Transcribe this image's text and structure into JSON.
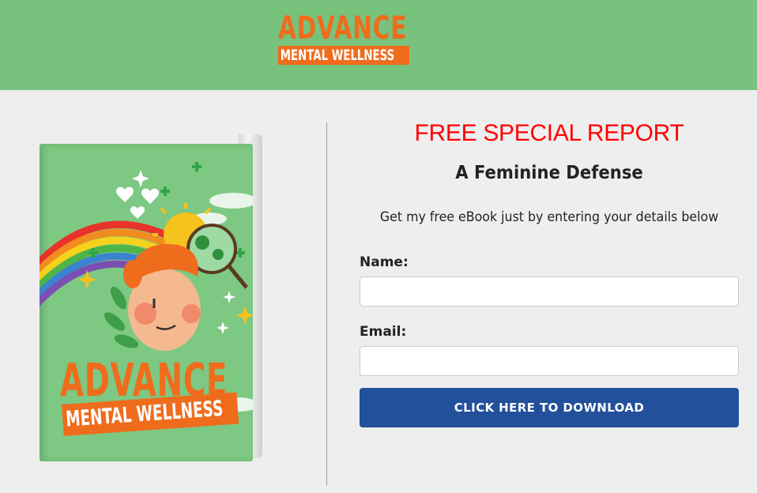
{
  "header": {
    "logo_title": "ADVANCE",
    "logo_subtitle": "MENTAL WELLNESS",
    "background_color": "#77c27d",
    "brand_color": "#ef6c1d"
  },
  "book": {
    "cover_title": "ADVANCE",
    "cover_subtitle": "MENTAL WELLNESS",
    "cover_color": "#7dc882"
  },
  "form": {
    "headline": "FREE SPECIAL REPORT",
    "headline_color": "#ff0000",
    "subheading": "A Feminine Defense",
    "description": "Get my free eBook just by entering your details below",
    "name_label": "Name:",
    "name_value": "",
    "email_label": "Email:",
    "email_value": "",
    "button_label": "CLICK HERE TO DOWNLOAD",
    "button_color": "#22509b"
  }
}
